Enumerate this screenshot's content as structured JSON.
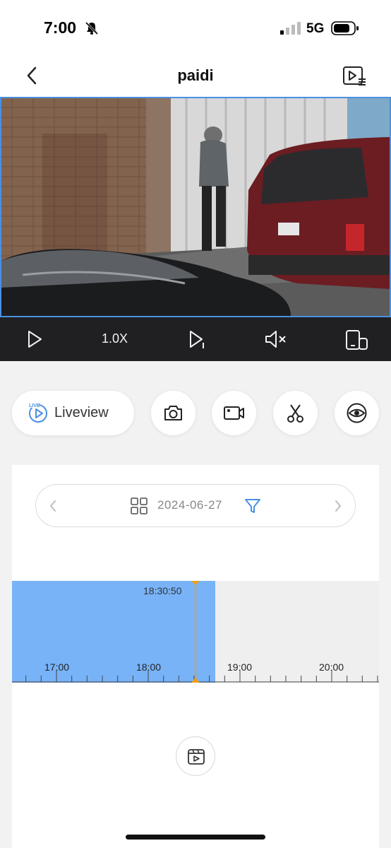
{
  "status_bar": {
    "time": "7:00",
    "network": "5G",
    "icons": [
      "bell-off-icon",
      "cellular-signal-icon",
      "battery-icon"
    ]
  },
  "nav": {
    "title": "paidi",
    "back_icon": "chevron-left-icon",
    "playlist_icon": "video-playlist-icon"
  },
  "video": {
    "scene": "security-camera-feed"
  },
  "player_controls": {
    "play_icon": "play-icon",
    "speed": "1.0X",
    "step_icon": "frame-step-icon",
    "mute_icon": "speaker-muted-icon",
    "orientation_icon": "rotate-screen-icon"
  },
  "actions": {
    "liveview_label": "Liveview",
    "liveview_badge": "LIVE",
    "buttons": [
      "camera-icon",
      "video-record-icon",
      "scissors-icon",
      "eye-icon"
    ]
  },
  "date_bar": {
    "date": "2024-06-27",
    "accent_color": "#4a90e2"
  },
  "timeline": {
    "cursor_time": "18:30:50",
    "hour_labels": [
      "17:00",
      "18:00",
      "19:00",
      "20:00"
    ],
    "recorded_color": "#78b3f8",
    "cursor_color": "#f39c12"
  },
  "clip_button": {
    "icon": "video-clip-icon"
  }
}
